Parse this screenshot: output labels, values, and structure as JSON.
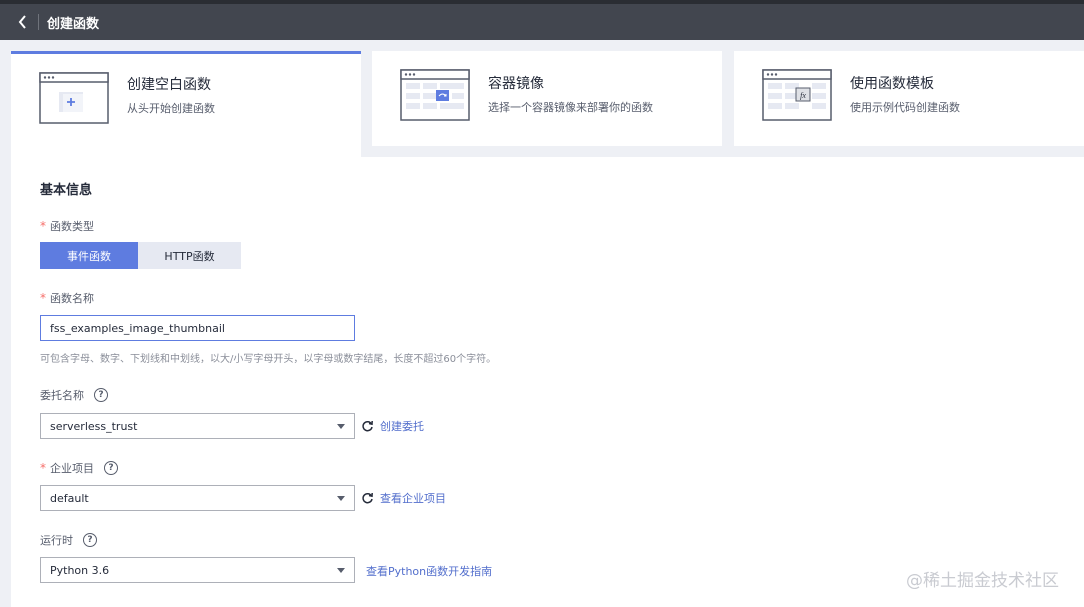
{
  "header": {
    "title": "创建函数"
  },
  "cards": [
    {
      "title": "创建空白函数",
      "desc": "从头开始创建函数"
    },
    {
      "title": "容器镜像",
      "desc": "选择一个容器镜像来部署你的函数"
    },
    {
      "title": "使用函数模板",
      "desc": "使用示例代码创建函数"
    }
  ],
  "section": {
    "title": "基本信息"
  },
  "func_type": {
    "label": "函数类型",
    "options": [
      "事件函数",
      "HTTP函数"
    ],
    "selected": "事件函数"
  },
  "func_name": {
    "label": "函数名称",
    "value": "fss_examples_image_thumbnail",
    "hint": "可包含字母、数字、下划线和中划线，以大/小写字母开头，以字母或数字结尾，长度不超过60个字符。"
  },
  "agency": {
    "label": "委托名称",
    "value": "serverless_trust",
    "link": "创建委托"
  },
  "project": {
    "label": "企业项目",
    "value": "default",
    "link": "查看企业项目"
  },
  "runtime": {
    "label": "运行时",
    "value": "Python 3.6",
    "link": "查看Python函数开发指南"
  },
  "watermark": "@稀土掘金技术社区",
  "colors": {
    "accent": "#5e7ce0",
    "header": "#42464f",
    "link": "#526ecc",
    "required": "#f66f6a"
  }
}
